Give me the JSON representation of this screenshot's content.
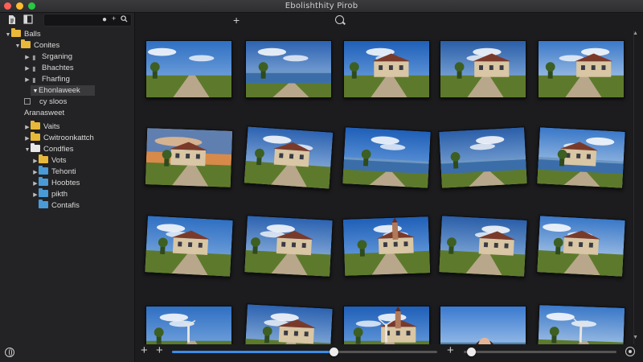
{
  "window": {
    "title": "Ebolishthity Pirob"
  },
  "sidebar": {
    "toolbar": {
      "icons": [
        "document-icon",
        "sidebar-toggle-icon",
        "user-icon",
        "add-icon",
        "search-icon"
      ]
    },
    "tree": [
      {
        "label": "Balls",
        "icon": "folder-yellow",
        "expanded": true
      },
      {
        "label": "Conites",
        "icon": "folder-yellow",
        "expanded": true
      },
      {
        "label": "Srganing",
        "icon": "placeholder"
      },
      {
        "label": "Bhachtes",
        "icon": "placeholder"
      },
      {
        "label": "Fharfing",
        "icon": "placeholder"
      },
      {
        "label": "Ehonlaweek",
        "icon": "placeholder",
        "selected": true
      },
      {
        "label": "cy sloos",
        "icon": "checkbox"
      },
      {
        "label": "Aranasweet",
        "icon": "none"
      },
      {
        "label": "Vaits",
        "icon": "folder-yellow"
      },
      {
        "label": "Cwitroonkattch",
        "icon": "folder-yellow"
      },
      {
        "label": "Condfies",
        "icon": "folder-white",
        "expanded": true
      },
      {
        "label": "Vots",
        "icon": "folder-yellow"
      },
      {
        "label": "Tehonti",
        "icon": "folder-blue"
      },
      {
        "label": "Hoobtes",
        "icon": "folder-blue"
      },
      {
        "label": "pikth",
        "icon": "folder-blue"
      },
      {
        "label": "Contafis",
        "icon": "folder-blue"
      }
    ]
  },
  "toolbar": {
    "add_icon": "plus-icon",
    "search_icon": "search-icon"
  },
  "bottombar": {
    "zoom_slider_value": 0.61,
    "secondary_slider_value": 0.02,
    "icons": [
      "plus-icon",
      "plus-icon",
      "plus-icon",
      "settings-icon"
    ]
  },
  "photos": [
    {
      "name": "road-field"
    },
    {
      "name": "lake-road"
    },
    {
      "name": "street-buildings"
    },
    {
      "name": "manor-house"
    },
    {
      "name": "villa-path"
    },
    {
      "name": "sunset-castle"
    },
    {
      "name": "farmhouse-1"
    },
    {
      "name": "river-path"
    },
    {
      "name": "lake-hills"
    },
    {
      "name": "chateau"
    },
    {
      "name": "farmhouse-2"
    },
    {
      "name": "farmhouse-3"
    },
    {
      "name": "church-house"
    },
    {
      "name": "farmhouse-4"
    },
    {
      "name": "farmhouse-5"
    },
    {
      "name": "blue-sky-tower"
    },
    {
      "name": "house-clouds"
    },
    {
      "name": "tower-clouds"
    },
    {
      "name": "portrait-woman"
    },
    {
      "name": "windmill-field"
    }
  ],
  "colors": {
    "accent": "#3b8ce8",
    "folder_yellow": "#e8b83a",
    "folder_blue": "#4a9ad8"
  }
}
